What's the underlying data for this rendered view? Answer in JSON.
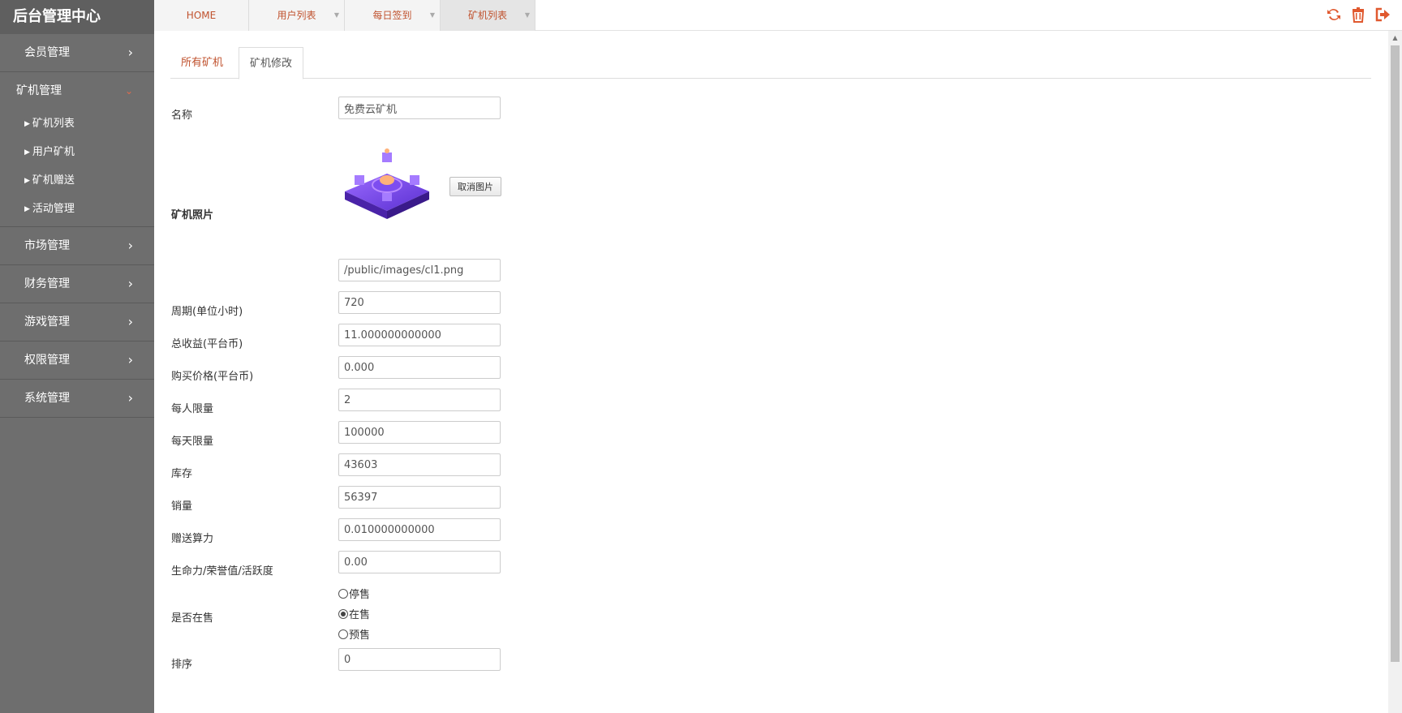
{
  "sidebar": {
    "brand": "后台管理中心",
    "groups": [
      {
        "label": "会员管理",
        "chev": "›"
      },
      {
        "label": "矿机管理",
        "chev": "⌄",
        "items": [
          "矿机列表",
          "用户矿机",
          "矿机赠送",
          "活动管理"
        ]
      },
      {
        "label": "市场管理",
        "chev": "›"
      },
      {
        "label": "财务管理",
        "chev": "›"
      },
      {
        "label": "游戏管理",
        "chev": "›"
      },
      {
        "label": "权限管理",
        "chev": "›"
      },
      {
        "label": "系统管理",
        "chev": "›"
      }
    ]
  },
  "topbar": {
    "tabs": [
      {
        "label": "HOME"
      },
      {
        "label": "用户列表",
        "close": "▼"
      },
      {
        "label": "每日签到",
        "close": "▼"
      },
      {
        "label": "矿机列表",
        "close": "▼"
      }
    ],
    "icons": [
      "refresh-icon",
      "trash-icon",
      "logout-icon"
    ],
    "icon_color": "#e0592f"
  },
  "subtabs": [
    "所有矿机",
    "矿机修改"
  ],
  "form": {
    "name_label": "名称",
    "name_value": "免费云矿机",
    "photo_label": "矿机照片",
    "cancel_image": "取消图片",
    "image_path": "/public/images/cl1.png",
    "period_label": "周期(单位小时)",
    "period_value": "720",
    "total_income_label": "总收益(平台币)",
    "total_income_value": "11.000000000000",
    "price_label": "购买价格(平台币)",
    "price_value": "0.000",
    "per_user_limit_label": "每人限量",
    "per_user_limit_value": "2",
    "daily_limit_label": "每天限量",
    "daily_limit_value": "100000",
    "stock_label": "库存",
    "stock_value": "43603",
    "sales_label": "销量",
    "sales_value": "56397",
    "gift_power_label": "赠送算力",
    "gift_power_value": "0.010000000000",
    "vitality_label": "生命力/荣誉值/活跃度",
    "vitality_value": "0.00",
    "on_sale_label": "是否在售",
    "on_sale_options": [
      "停售",
      "在售",
      "预售"
    ],
    "on_sale_selected": "在售",
    "sort_label": "排序",
    "sort_value": "0"
  }
}
